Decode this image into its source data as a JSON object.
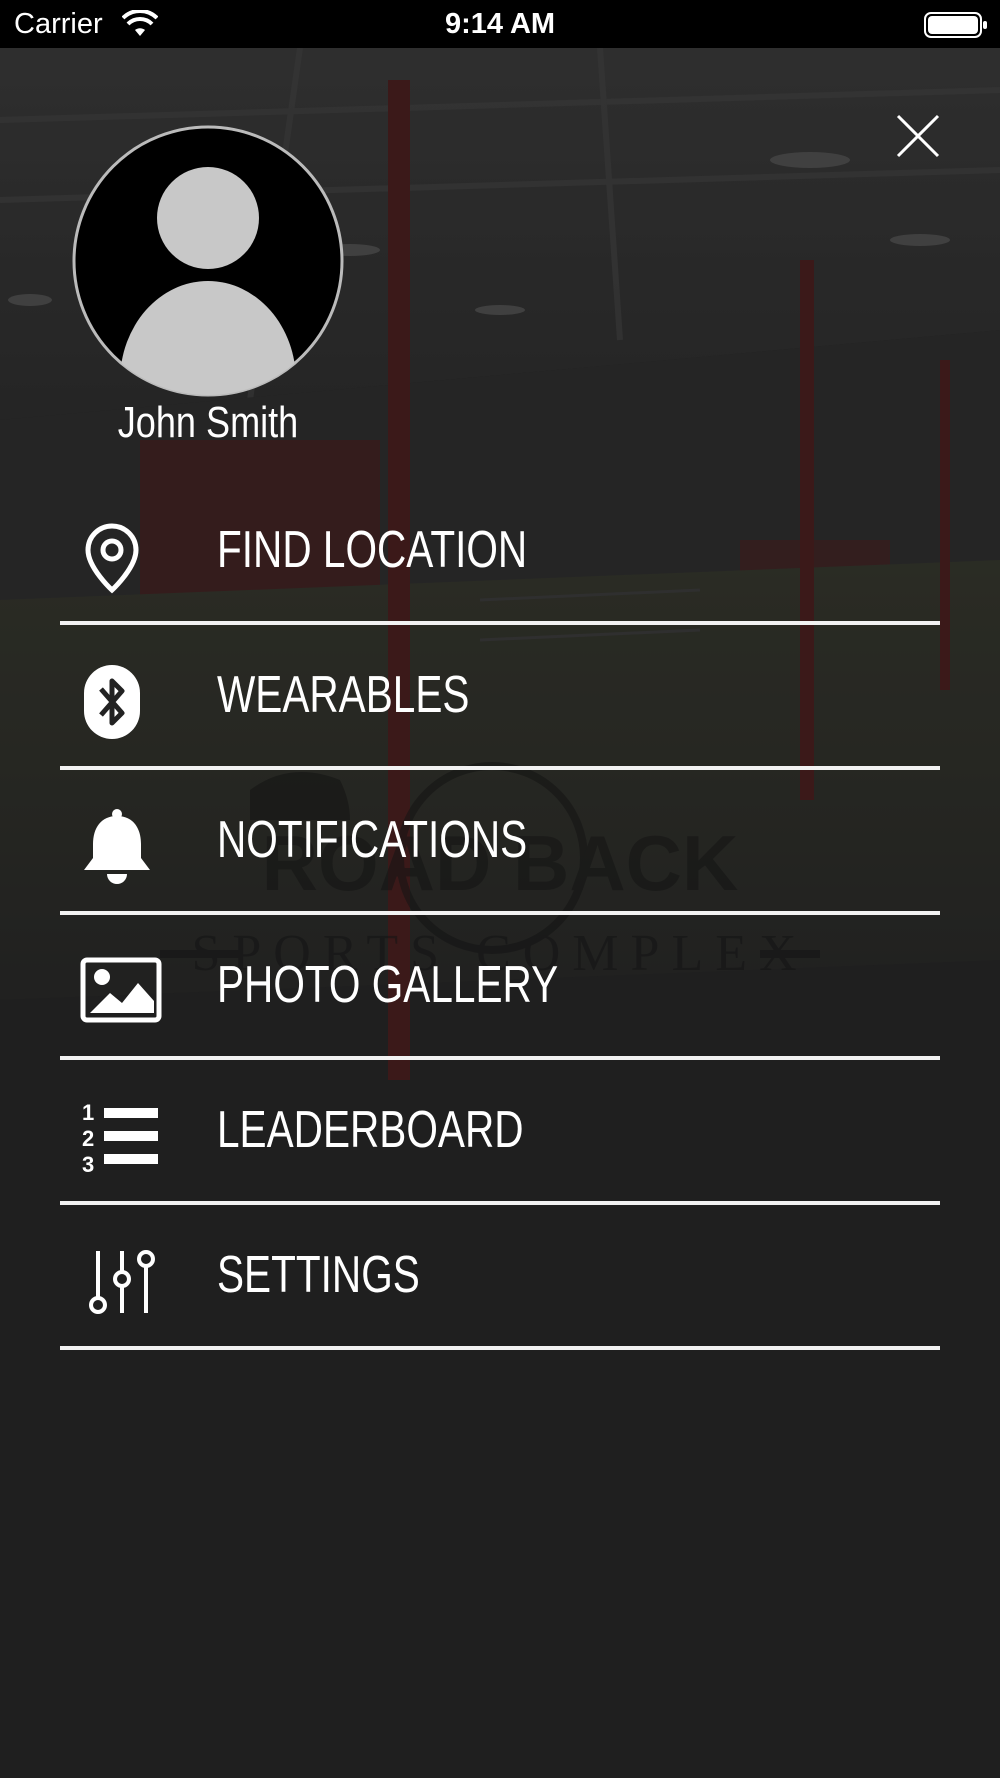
{
  "status_bar": {
    "carrier": "Carrier",
    "time": "9:14 AM"
  },
  "profile": {
    "name": "John Smith"
  },
  "menu": {
    "items": [
      {
        "label": "FIND LOCATION",
        "icon": "map-pin-icon"
      },
      {
        "label": "WEARABLES",
        "icon": "bluetooth-icon"
      },
      {
        "label": "NOTIFICATIONS",
        "icon": "bell-icon"
      },
      {
        "label": "PHOTO GALLERY",
        "icon": "image-icon"
      },
      {
        "label": "LEADERBOARD",
        "icon": "numbered-list-icon"
      },
      {
        "label": "SETTINGS",
        "icon": "sliders-icon"
      }
    ]
  },
  "background": {
    "watermark_text": "ROAD BACK",
    "watermark_subtext": "SPORTS COMPLEX",
    "overlay_color": "#1e1e1e",
    "accent_red": "#6b1e1e"
  }
}
